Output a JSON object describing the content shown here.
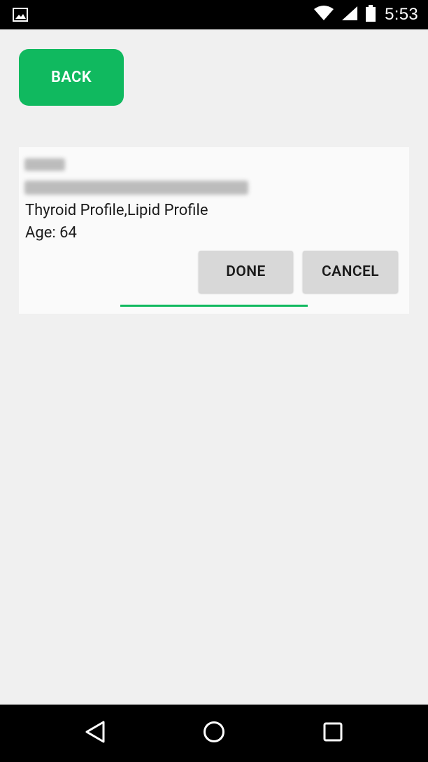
{
  "status_bar": {
    "time": "5:53",
    "icons": [
      "image-icon",
      "wifi-icon",
      "signal-icon",
      "battery-icon"
    ]
  },
  "back_button": {
    "label": "BACK"
  },
  "card": {
    "tests": "Thyroid Profile,Lipid Profile",
    "age": "Age: 64",
    "done_label": "DONE",
    "cancel_label": "CANCEL"
  },
  "nav_bar": {
    "icons": [
      "back-triangle-icon",
      "home-circle-icon",
      "recents-square-icon"
    ]
  },
  "colors": {
    "accent": "#10b95f",
    "background": "#f0f0f0",
    "card": "#fafafa",
    "button_gray": "#d8d8d8"
  }
}
